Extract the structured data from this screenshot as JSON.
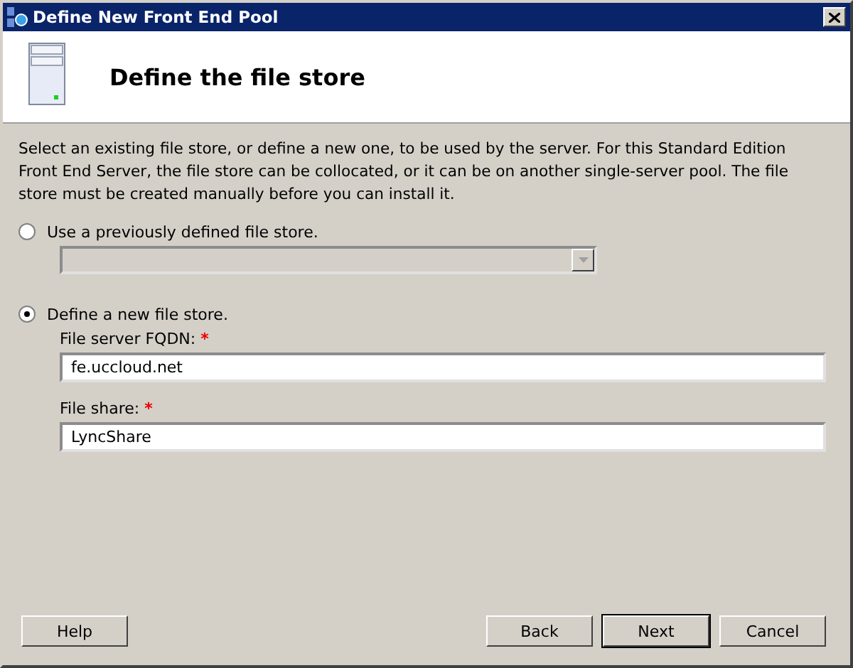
{
  "window": {
    "title": "Define New Front End Pool"
  },
  "header": {
    "title": "Define the file store"
  },
  "description": "Select an existing file store, or define a new one, to be used by the server. For this Standard Edition Front End Server, the file store can be collocated, or it can be on another single-server pool. The file store must be created manually before you can install it.",
  "options": [
    {
      "label": "Use a previously defined file store.",
      "selected": false,
      "kind": "combo",
      "disabled": true
    },
    {
      "label": "Define a new file store.",
      "selected": true,
      "kind": "fields",
      "fields": [
        {
          "label": "File server FQDN:",
          "required_mark": "*",
          "value": "fe.uccloud.net"
        },
        {
          "label": "File share:",
          "required_mark": "*",
          "value": "LyncShare"
        }
      ]
    }
  ],
  "buttons": [
    {
      "label": "Help",
      "default": false,
      "kind": "left"
    },
    {
      "label": "Back",
      "default": false,
      "kind": "right"
    },
    {
      "label": "Next",
      "default": true,
      "kind": "right"
    },
    {
      "label": "Cancel",
      "default": false,
      "kind": "right"
    }
  ]
}
